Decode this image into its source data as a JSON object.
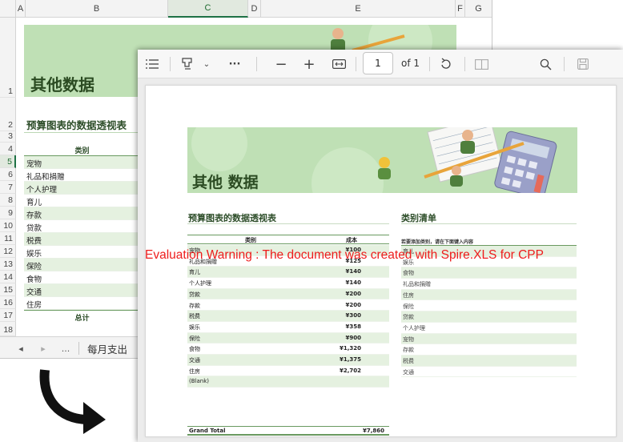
{
  "excel": {
    "columns": [
      "A",
      "B",
      "C",
      "D",
      "E",
      "F",
      "G"
    ],
    "rows": [
      "1",
      "2",
      "3",
      "4",
      "5",
      "6",
      "7",
      "8",
      "9",
      "10",
      "11",
      "12",
      "13",
      "14",
      "15",
      "16",
      "17",
      "18"
    ],
    "banner_title": "其他数据",
    "pivot_title": "预算图表的数据透视表",
    "category_header": "类别",
    "categories": [
      "宠物",
      "礼品和捐赠",
      "个人护理",
      "育儿",
      "存款",
      "贷款",
      "税费",
      "娱乐",
      "保险",
      "食物",
      "交通",
      "住房"
    ],
    "total_label": "总计",
    "sheet_tab": "每月支出",
    "tab_more": "..."
  },
  "pdf_viewer": {
    "toolbar": {
      "contents_icon": "contents-icon",
      "draw_icon": "highlighter-icon",
      "dropdown_icon": "chevron-down-icon",
      "more_label": "···",
      "zoom_out_label": "−",
      "zoom_in_label": "+",
      "fit_icon": "fit-width-icon",
      "page_number": "1",
      "page_of": "of 1",
      "rotate_icon": "rotate-icon",
      "two_page_icon": "two-page-icon",
      "search_icon": "search-icon",
      "save_icon": "save-icon"
    },
    "document": {
      "banner_title": "其他 数据",
      "pivot_title": "预算图表的数据透视表",
      "pivot_headers": [
        "类别",
        "成本"
      ],
      "pivot_rows": [
        {
          "category": "宠物",
          "cost": "¥100"
        },
        {
          "category": "礼品和捐赠",
          "cost": "¥125"
        },
        {
          "category": "育儿",
          "cost": "¥140"
        },
        {
          "category": "个人护理",
          "cost": "¥140"
        },
        {
          "category": "贷款",
          "cost": "¥200"
        },
        {
          "category": "存款",
          "cost": "¥200"
        },
        {
          "category": "税费",
          "cost": "¥300"
        },
        {
          "category": "娱乐",
          "cost": "¥358"
        },
        {
          "category": "保险",
          "cost": "¥900"
        },
        {
          "category": "食物",
          "cost": "¥1,320"
        },
        {
          "category": "交通",
          "cost": "¥1,375"
        },
        {
          "category": "住房",
          "cost": "¥2,702"
        },
        {
          "category": "(Blank)",
          "cost": ""
        }
      ],
      "grand_total_label": "Grand Total",
      "grand_total_value": "¥7,860",
      "category_list_title": "类别清单",
      "category_list_hint": "若要添加类别，请在下面键入内容",
      "category_list": [
        "育儿",
        "娱乐",
        "食物",
        "礼品和捐赠",
        "住房",
        "保险",
        "贷款",
        "个人护理",
        "宠物",
        "存款",
        "税费",
        "交通"
      ],
      "watermark": "Evaluation Warning : The document was created with  Spire.XLS for CPP"
    }
  },
  "colors": {
    "banner": "#bfe0b5",
    "heading": "#2e4e2a",
    "row_alt": "#e5f1e0",
    "watermark": "#ee1c1c"
  }
}
